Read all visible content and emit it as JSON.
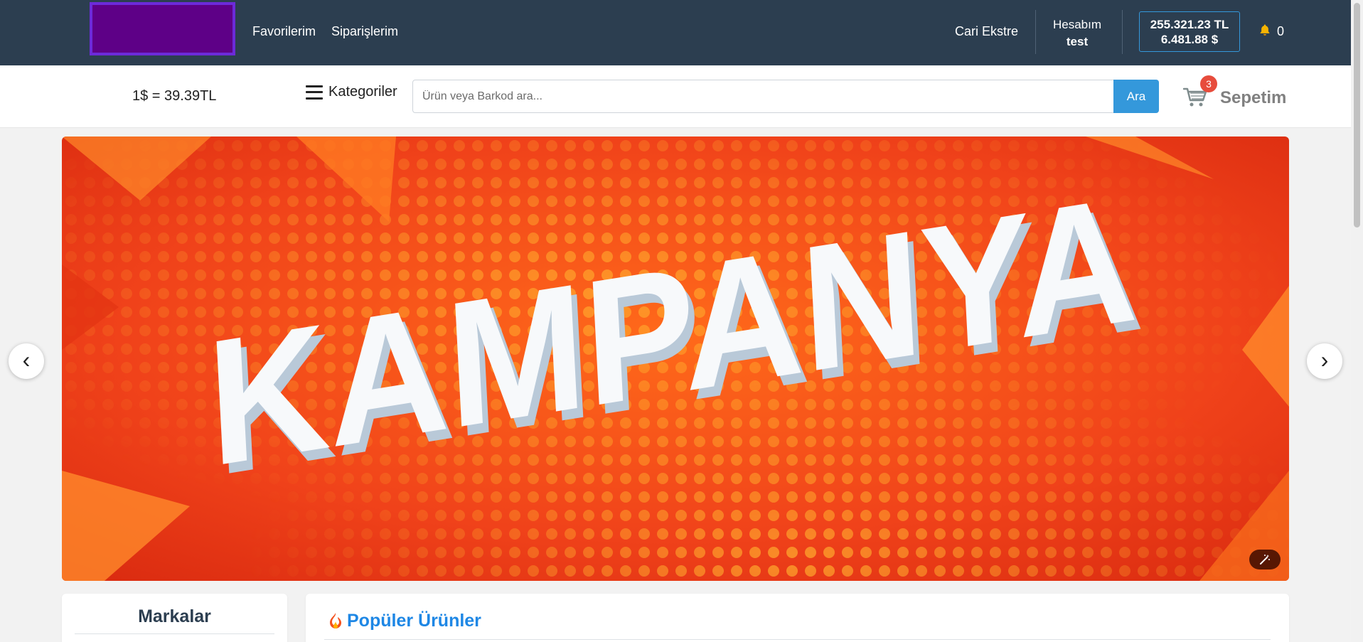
{
  "header": {
    "links": [
      "Favorilerim",
      "Siparişlerim"
    ],
    "cari_ekstre": "Cari Ekstre",
    "account_label": "Hesabım",
    "account_user": "test",
    "balance_tl": "255.321.23 TL",
    "balance_usd": "6.481.88 $",
    "notification_count": "0"
  },
  "subbar": {
    "exchange_rate": "1$ = 39.39TL",
    "categories_label": "Kategoriler",
    "search_placeholder": "Ürün veya Barkod ara...",
    "search_button": "Ara",
    "cart_badge": "3",
    "cart_label": "Sepetim"
  },
  "banner": {
    "text": "KAMPANYA",
    "prev": "‹",
    "next": "›"
  },
  "sections": {
    "brands_title": "Markalar",
    "popular_title": "Popüler Ürünler"
  },
  "icons": [
    "bell-icon",
    "cart-icon",
    "hamburger-icon",
    "fire-icon",
    "magic-wand-icon"
  ],
  "colors": {
    "topbar": "#2c3e50",
    "accent": "#3498db",
    "badge": "#e74c3c",
    "popular_title": "#1e87e5"
  }
}
